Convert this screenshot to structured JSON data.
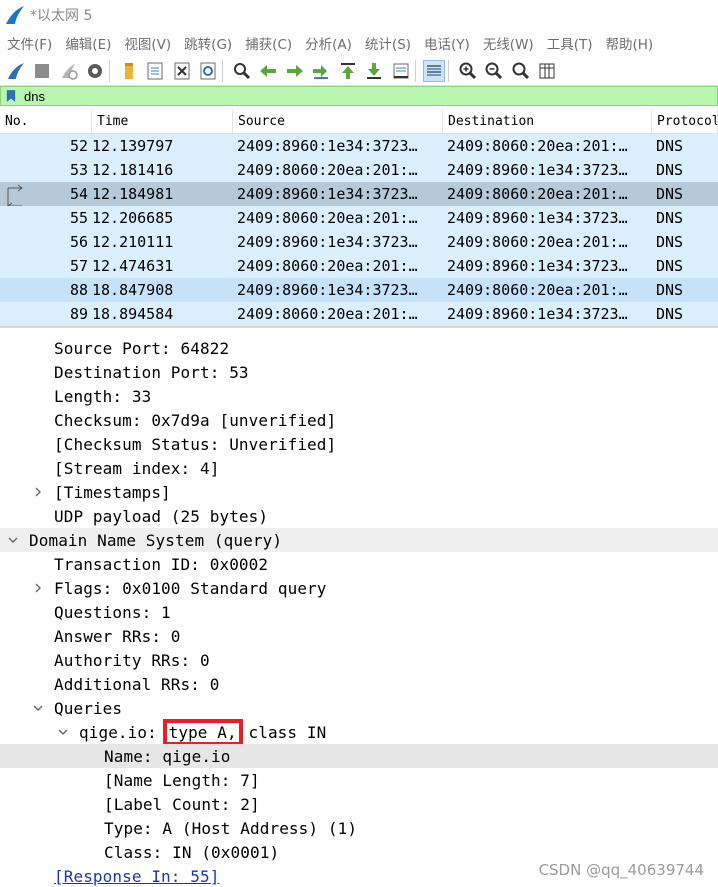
{
  "window": {
    "title": "*以太网 5"
  },
  "menu": [
    "文件(F)",
    "编辑(E)",
    "视图(V)",
    "跳转(G)",
    "捕获(C)",
    "分析(A)",
    "统计(S)",
    "电话(Y)",
    "无线(W)",
    "工具(T)",
    "帮助(H)"
  ],
  "toolbar": {
    "icons": [
      "start-capture-icon",
      "stop-capture-icon",
      "restart-capture-icon",
      "capture-options-icon",
      "open-file-icon",
      "save-file-icon",
      "close-file-icon",
      "reload-file-icon",
      "find-packet-icon",
      "go-back-icon",
      "go-forward-icon",
      "go-to-packet-icon",
      "go-first-icon",
      "go-last-icon",
      "autoscroll-icon",
      "colorize-icon",
      "zoom-in-icon",
      "zoom-out-icon",
      "zoom-normal-icon",
      "resize-columns-icon"
    ]
  },
  "filter": {
    "value": "dns"
  },
  "packet_list": {
    "headers": [
      "No.",
      "Time",
      "Source",
      "Destination",
      "Protocol"
    ],
    "rows": [
      {
        "no": "52",
        "time": "12.139797",
        "src": "2409:8960:1e34:3723…",
        "dst": "2409:8060:20ea:201:…",
        "proto": "DNS"
      },
      {
        "no": "53",
        "time": "12.181416",
        "src": "2409:8060:20ea:201:…",
        "dst": "2409:8960:1e34:3723…",
        "proto": "DNS"
      },
      {
        "no": "54",
        "time": "12.184981",
        "src": "2409:8960:1e34:3723…",
        "dst": "2409:8060:20ea:201:…",
        "proto": "DNS"
      },
      {
        "no": "55",
        "time": "12.206685",
        "src": "2409:8060:20ea:201:…",
        "dst": "2409:8960:1e34:3723…",
        "proto": "DNS"
      },
      {
        "no": "56",
        "time": "12.210111",
        "src": "2409:8960:1e34:3723…",
        "dst": "2409:8060:20ea:201:…",
        "proto": "DNS"
      },
      {
        "no": "57",
        "time": "12.474631",
        "src": "2409:8060:20ea:201:…",
        "dst": "2409:8960:1e34:3723…",
        "proto": "DNS"
      },
      {
        "no": "88",
        "time": "18.847908",
        "src": "2409:8960:1e34:3723…",
        "dst": "2409:8060:20ea:201:…",
        "proto": "DNS"
      },
      {
        "no": "89",
        "time": "18.894584",
        "src": "2409:8060:20ea:201:…",
        "dst": "2409:8960:1e34:3723…",
        "proto": "DNS"
      }
    ]
  },
  "details": {
    "source_port": "Source Port: 64822",
    "destination_port": "Destination Port: 53",
    "length": "Length: 33",
    "checksum": "Checksum: 0x7d9a [unverified]",
    "checksum_status": "[Checksum Status: Unverified]",
    "stream_index": "[Stream index: 4]",
    "timestamps": "[Timestamps]",
    "udp_payload": "UDP payload (25 bytes)",
    "dns_section": "Domain Name System (query)",
    "transaction_id": "Transaction ID: 0x0002",
    "flags": "Flags: 0x0100 Standard query",
    "questions": "Questions: 1",
    "answer_rrs": "Answer RRs: 0",
    "authority_rrs": "Authority RRs: 0",
    "additional_rrs": "Additional RRs: 0",
    "queries": "Queries",
    "query_prefix": "qige.io: ",
    "query_type": "type A,",
    "query_suffix": " class IN",
    "name": "Name: qige.io",
    "name_length": "[Name Length: 7]",
    "label_count": "[Label Count: 2]",
    "type": "Type: A (Host Address) (1)",
    "class": "Class: IN (0x0001)",
    "response_in": "[Response In: 55]"
  },
  "watermark": "CSDN @qq_40639744",
  "colors": {
    "row_bg": "#dbeefb",
    "row_selected": "#b6c9d8",
    "filter_bg": "#b9f6b0",
    "link": "#1a35c6",
    "highlight_box": "#ee1c24"
  }
}
